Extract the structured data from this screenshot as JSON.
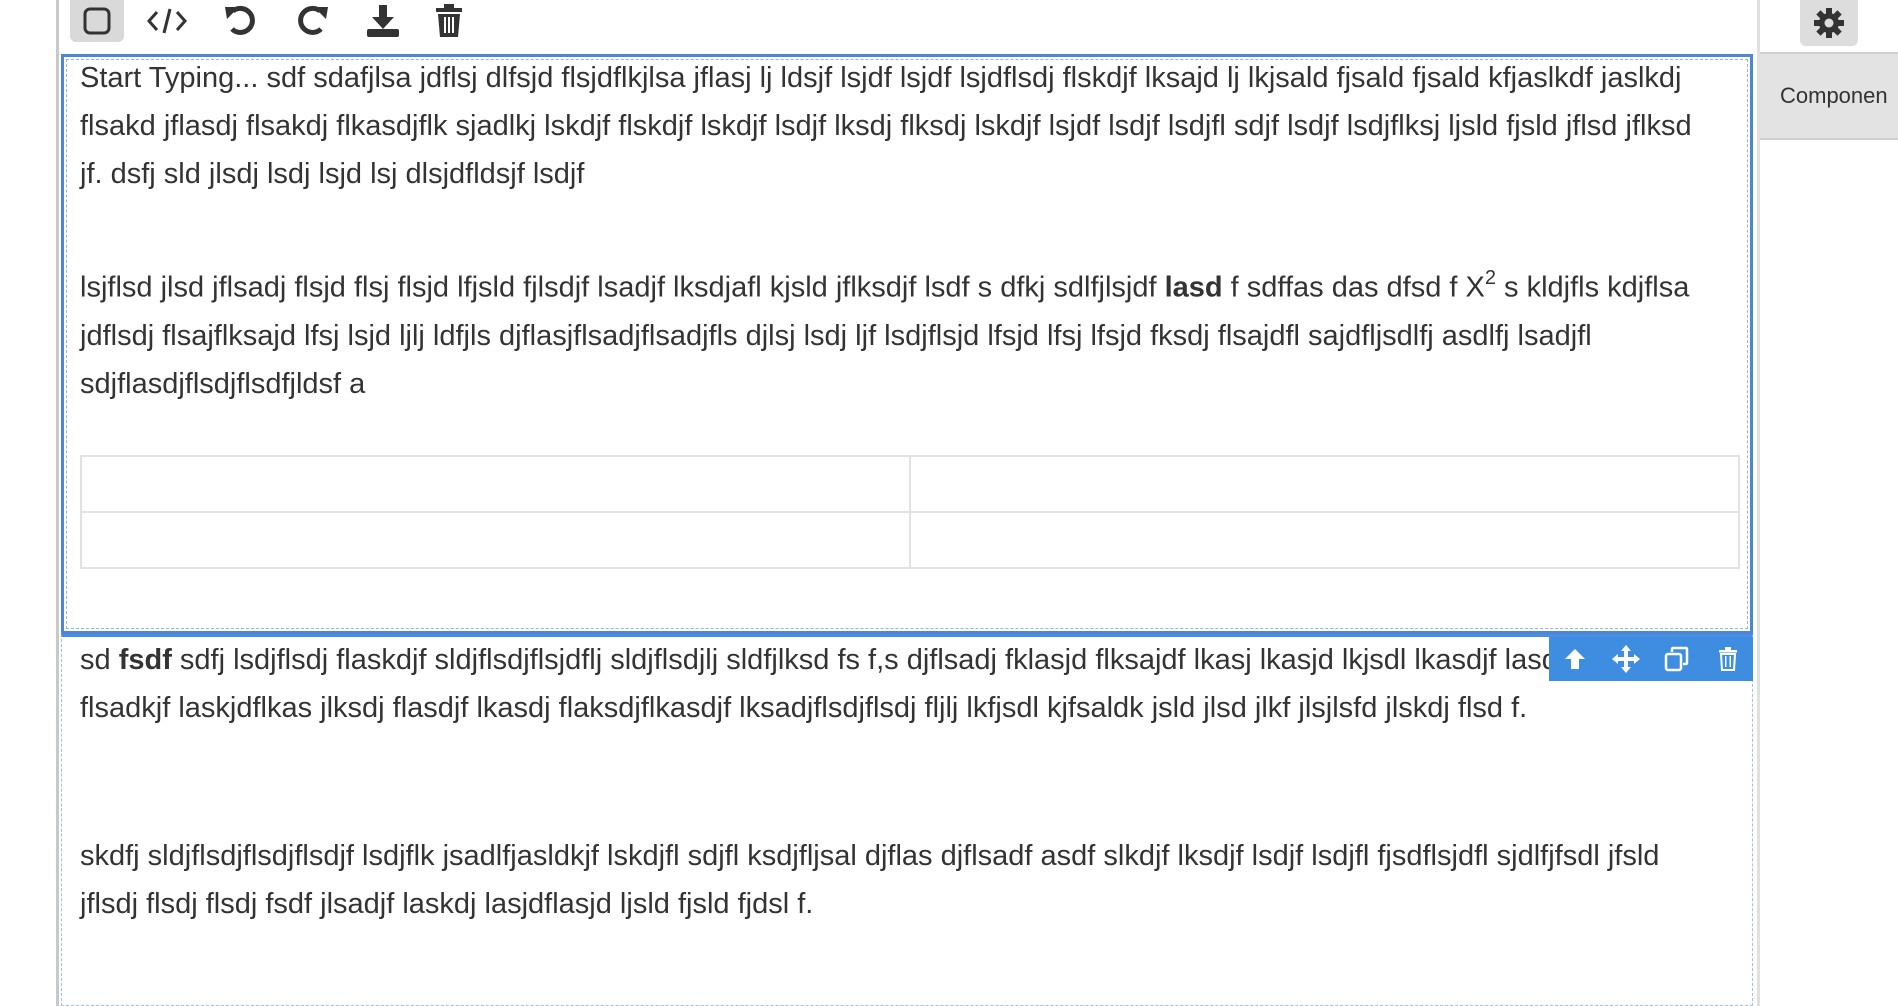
{
  "toolbar": {
    "buttons": [
      {
        "id": "square",
        "icon": "square-outline-icon"
      },
      {
        "id": "code",
        "icon": "code-icon"
      },
      {
        "id": "undo",
        "icon": "undo-icon"
      },
      {
        "id": "redo",
        "icon": "redo-icon"
      },
      {
        "id": "download",
        "icon": "download-icon"
      },
      {
        "id": "trash",
        "icon": "trash-icon"
      }
    ]
  },
  "panel": {
    "settings_icon": "gear-icon",
    "components_label": "Componen"
  },
  "blocks": {
    "selected": {
      "para1": "Start Typing... sdf sdafjlsa jdflsj dlfsjd flsjdflkjlsa jflasj lj ldsjf lsjdf lsjdf lsjdflsdj flskdjf lksajd lj lkjsald fjsald fjsald kfjaslkdf jaslkdj flsakd jflasdj flsakdj flkasdjflk sjadlkj lskdjf flskdjf lskdjf lsdjf lksdj flksdj lskdjf lsjdf lsdjf lsdjfl sdjf lsdjf lsdjflksj ljsld fjsld jflsd jflksd jf. dsfj sld jlsdj lsdj lsjd lsj dlsjdfldsjf lsdjf",
      "para2_a": "lsjflsd jlsd jflsadj flsjd flsj flsjd lfjsld fjlsdjf lsadjf lksdjafl kjsld jflksdjf lsdf s dfkj sdlfjlsjdf ",
      "para2_bold": "lasd",
      "para2_b": " f sdffas das dfsd f X",
      "para2_sup": "2",
      "para2_c": " s kldjfls kdjflsa jdflsdj flsajflksajd lfsj lsjd ljlj ldfjls djflasjflsadjflsadjfls djlsj lsdj ljf lsdjflsjd lfsjd lfsj lfsjd fksdj flsajdfl sajdfljsdlfj asdlfj lsadjfl sdjflasdjflsdjflsdfjldsf a",
      "table_rows": [
        [
          "",
          ""
        ],
        [
          "",
          ""
        ]
      ]
    },
    "hover": {
      "para1_a": "sd ",
      "para1_bold": "fsdf",
      "para1_b": " sdfj lsdjflsdj flaskdjf sldjflsdjflsjdflj sldjflsdjlj sldfjlksd fs f,s djflsadj fklasjd flksajdf lkasj lkasjd lkjsdl lkasdjf lasdj flsajd flsadkjf laskjdflkas jlksdj flasdjf lkasdj flaksdjflkasdjf lksadjflsdjflsdj fljlj lkfjsdl kjfsaldk jsld jlsd jlkf jlsjlsfd jlskdj flsd f.",
      "para2": "skdfj sldjflsdjflsdjflsdjf lsdjflk jsadlfjasldkjf lskdjfl sdjfl ksdjfljsal djflas djflsadf asdf slkdjf lksdjf lsdjf lsdjfl fjsdflsjdfl sjdlfjfsdl jfsld jflsdj flsdj flsdj fsdf jlsadjf laskdj lasjdflasjd ljsld fjsld fjdsl f.",
      "tools": [
        "arrow-up-icon",
        "move-icon",
        "clone-icon",
        "trash-icon"
      ]
    }
  }
}
